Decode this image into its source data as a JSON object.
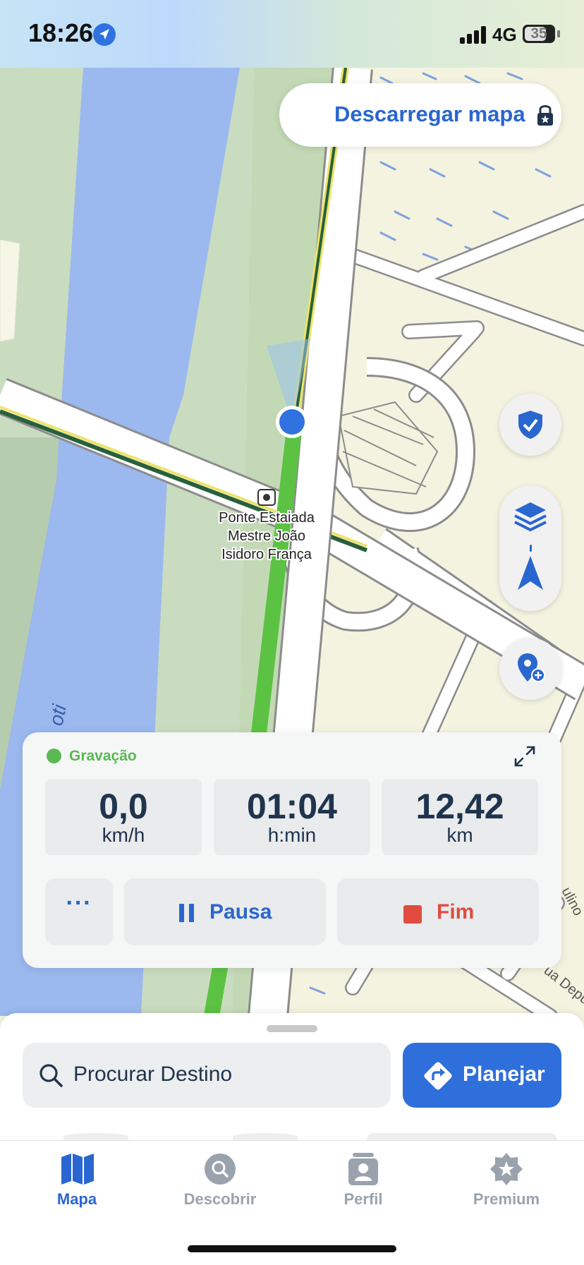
{
  "status_bar": {
    "time": "18:26",
    "network": "4G",
    "battery": "35"
  },
  "map": {
    "download_label": "Descarregar mapa",
    "poi_label_lines": [
      "Ponte Estaiada",
      "Mestre João",
      "Isidoro França"
    ],
    "river_label": "oti",
    "street_label_1": "ulino",
    "street_label_2": "ua Depu",
    "colors": {
      "river": "#9bb8ef",
      "park": "#c9dcbf",
      "land": "#f3f3e0",
      "route": "#5cc243",
      "road": "#ffffff",
      "location": "#2f72e0"
    }
  },
  "side_buttons": {
    "safety": "shield-check-icon",
    "layers": "layers-icon",
    "navigate": "navigation-arrow-icon",
    "add_place": "pin-plus-icon"
  },
  "recording": {
    "status": "Gravação",
    "speed": {
      "value": "0,0",
      "unit": "km/h"
    },
    "duration": {
      "value": "01:04",
      "unit": "h:min"
    },
    "distance": {
      "value": "12,42",
      "unit": "km"
    },
    "more_label": "···",
    "pause_label": "Pausa",
    "stop_label": "Fim"
  },
  "search": {
    "placeholder": "Procurar Destino",
    "plan_label": "Planejar"
  },
  "tabs": [
    {
      "label": "Mapa",
      "icon": "map-icon",
      "active": true
    },
    {
      "label": "Descobrir",
      "icon": "discover-icon",
      "active": false
    },
    {
      "label": "Perfil",
      "icon": "profile-icon",
      "active": false
    },
    {
      "label": "Premium",
      "icon": "premium-star-icon",
      "active": false
    }
  ],
  "colors": {
    "accent": "#2a66cf",
    "recording": "#5ab953",
    "stop": "#e04c42",
    "inactive_tab": "#9aa3ad"
  }
}
